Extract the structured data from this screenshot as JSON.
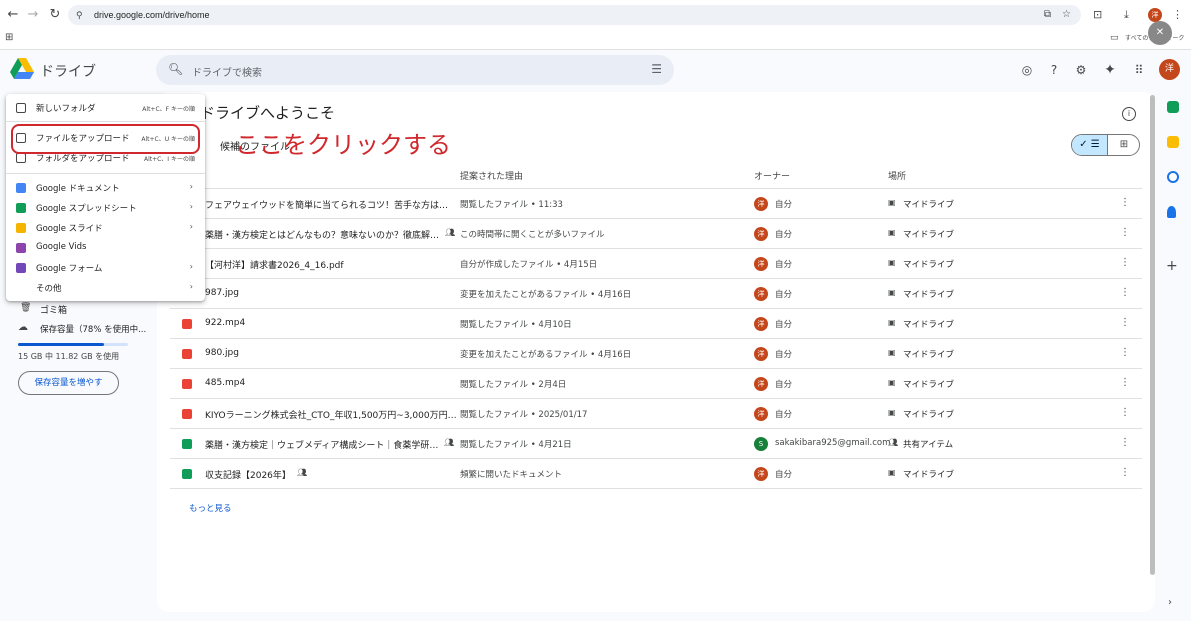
{
  "browser": {
    "url": "drive.google.com/drive/home",
    "bookmark_label": "すべてのブックマーク",
    "profile_initial": "洋"
  },
  "header": {
    "brand": "ドライブ",
    "search_placeholder": "ドライブで検索",
    "avatar_initial": "洋"
  },
  "main": {
    "welcome": "ドライブへようこそ",
    "suggested_label": "候補のファイル",
    "columns": {
      "reason": "提案された理由",
      "owner": "オーナー",
      "location": "場所"
    },
    "rows": [
      {
        "name": "フェアウェイウッドを簡単に当てられるコツ！苦手な方は…",
        "reason": "閲覧したファイル • 11:33",
        "owner": "自分",
        "owner_initial": "洋",
        "location": "マイドライブ",
        "icon": "doc-icon",
        "shared": false
      },
      {
        "name": "薬膳・漢方検定とはどんなもの？意味ないのか？徹底解…",
        "reason": "この時間帯に開くことが多いファイル",
        "owner": "自分",
        "owner_initial": "洋",
        "location": "マイドライブ",
        "icon": "doc-icon",
        "shared": true
      },
      {
        "name": "【河村洋】請求書2026_4_16.pdf",
        "reason": "自分が作成したファイル • 4月15日",
        "owner": "自分",
        "owner_initial": "洋",
        "location": "マイドライブ",
        "icon": "pdf-icon",
        "shared": false
      },
      {
        "name": "987.jpg",
        "reason": "変更を加えたことがあるファイル • 4月16日",
        "owner": "自分",
        "owner_initial": "洋",
        "location": "マイドライブ",
        "icon": "image-icon",
        "shared": false
      },
      {
        "name": "922.mp4",
        "reason": "閲覧したファイル • 4月10日",
        "owner": "自分",
        "owner_initial": "洋",
        "location": "マイドライブ",
        "icon": "video-icon",
        "shared": false
      },
      {
        "name": "980.jpg",
        "reason": "変更を加えたことがあるファイル • 4月16日",
        "owner": "自分",
        "owner_initial": "洋",
        "location": "マイドライブ",
        "icon": "image-icon",
        "shared": false
      },
      {
        "name": "485.mp4",
        "reason": "閲覧したファイル • 2月4日",
        "owner": "自分",
        "owner_initial": "洋",
        "location": "マイドライブ",
        "icon": "video-icon",
        "shared": false
      },
      {
        "name": "KIYOラーニング株式会社_CTO_年収1,500万円~3,000万円…",
        "reason": "閲覧したファイル • 2025/01/17",
        "owner": "自分",
        "owner_initial": "洋",
        "location": "マイドライブ",
        "icon": "pdf-icon",
        "shared": false
      },
      {
        "name": "薬膳・漢方検定｜ウェブメディア構成シート｜食薬学研…",
        "reason": "閲覧したファイル • 4月21日",
        "owner": "sakakibara925@gmail.com",
        "owner_initial": "S",
        "location": "共有アイテム",
        "icon": "sheet-icon",
        "shared": true
      },
      {
        "name": "収支記録【2026年】",
        "reason": "頻繁に開いたドキュメント",
        "owner": "自分",
        "owner_initial": "洋",
        "location": "マイドライブ",
        "icon": "sheet-icon",
        "shared": true
      }
    ],
    "more_link": "もっと見る"
  },
  "nav": {
    "trash": "ゴミ箱",
    "storage": "保存容量（78% を使用中...",
    "storage_used_fraction": 0.78,
    "storage_detail": "15 GB 中 11.82 GB を使用",
    "buy_storage": "保存容量を増やす"
  },
  "menu": {
    "items": [
      {
        "label": "新しいフォルダ",
        "shortcut": "Alt+C、F キーの順"
      },
      {
        "label": "ファイルをアップロード",
        "shortcut": "Alt+C、U キーの順"
      },
      {
        "label": "フォルダをアップロード",
        "shortcut": "Alt+C、I キーの順"
      },
      {
        "label": "Google ドキュメント"
      },
      {
        "label": "Google スプレッドシート"
      },
      {
        "label": "Google スライド"
      },
      {
        "label": "Google Vids"
      },
      {
        "label": "Google フォーム"
      },
      {
        "label": "その他"
      }
    ]
  },
  "annotation": "ここをクリックする",
  "colors": {
    "annotation_red": "#d0282d",
    "avatar": "#c4461b",
    "accent_blue": "#0b57d0",
    "selected_toggle": "#c2e7ff"
  }
}
